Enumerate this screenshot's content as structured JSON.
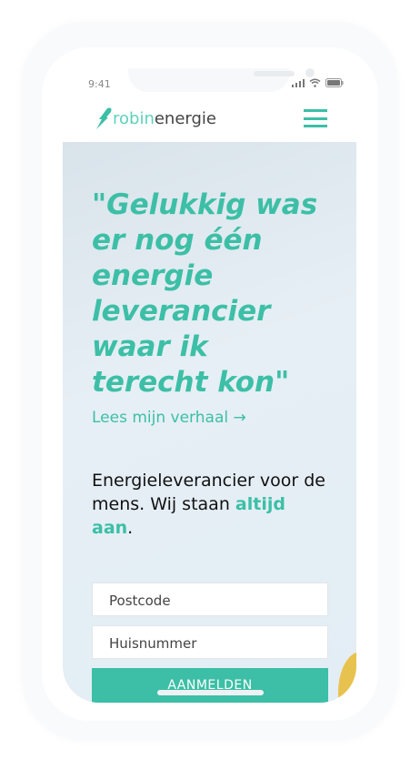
{
  "status": {
    "time": "9:41"
  },
  "header": {
    "logo_part1": "robin",
    "logo_part2": "energie"
  },
  "hero": {
    "quote": "\"Gelukkig was er nog één energie leverancier waar ik terecht kon\"",
    "link": "Lees mijn verhaal →",
    "tagline_pre": "Energieleverancier voor de mens. Wij staan ",
    "tagline_bold": "altijd aan",
    "tagline_post": "."
  },
  "form": {
    "postcode_placeholder": "Postcode",
    "huisnummer_placeholder": "Huisnummer",
    "submit": "AANMELDEN"
  },
  "colors": {
    "accent": "#3cbfa6"
  }
}
